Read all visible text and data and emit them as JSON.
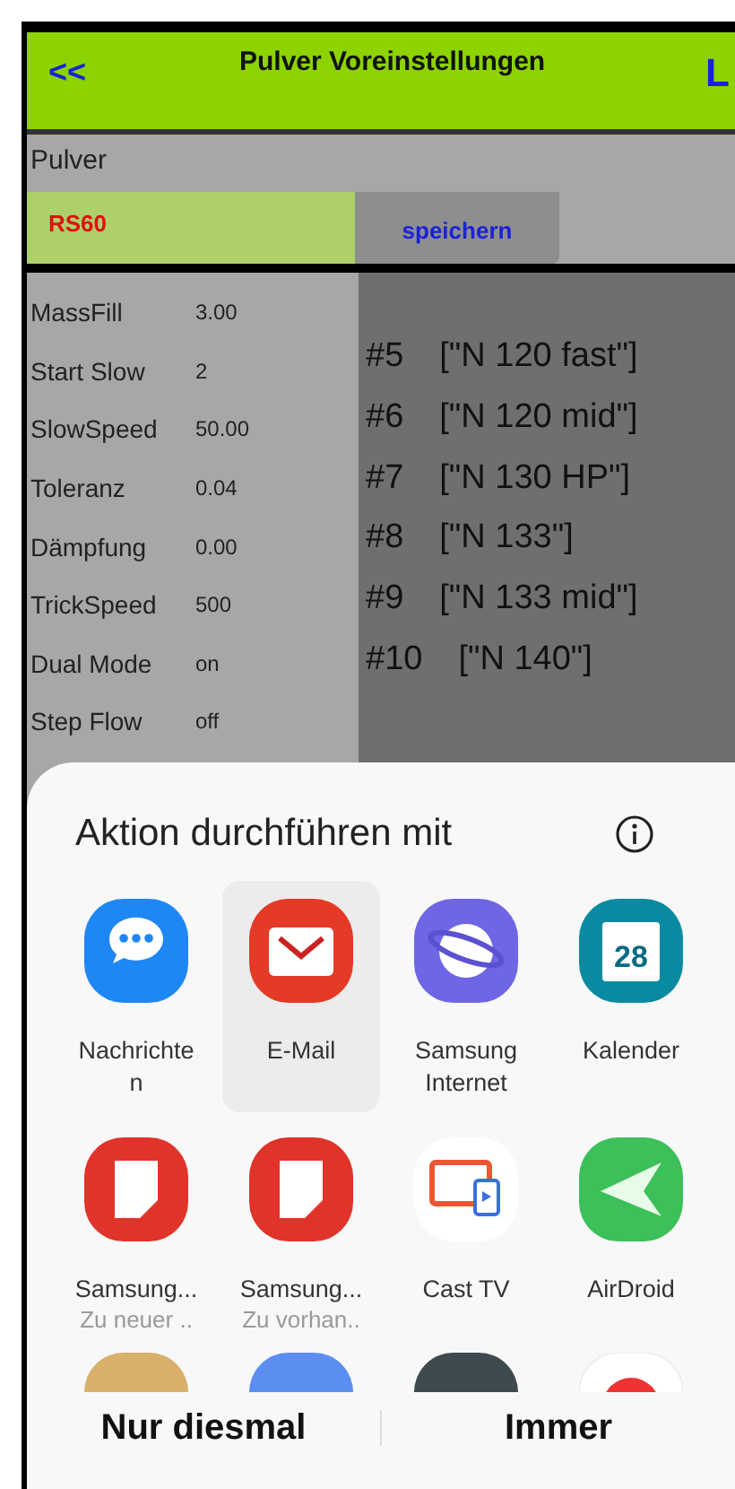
{
  "header": {
    "back": "<<",
    "title": "Pulver Voreinstellungen",
    "right": "L"
  },
  "powder": {
    "label": "Pulver",
    "value": "RS60",
    "save": "speichern"
  },
  "params": [
    {
      "name": "MassFill",
      "value": "3.00"
    },
    {
      "name": "Start Slow",
      "value": "2"
    },
    {
      "name": "SlowSpeed",
      "value": "50.00"
    },
    {
      "name": "Toleranz",
      "value": "0.04"
    },
    {
      "name": "Dämpfung",
      "value": "0.00"
    },
    {
      "name": "TrickSpeed",
      "value": "500"
    },
    {
      "name": "Dual Mode",
      "value": "on"
    },
    {
      "name": "Step Flow",
      "value": "off"
    }
  ],
  "presets": [
    {
      "number": "#5",
      "name": "[\"N 120 fast\"]"
    },
    {
      "number": "#6",
      "name": "[\"N 120 mid\"]"
    },
    {
      "number": "#7",
      "name": "[\"N 130 HP\"]"
    },
    {
      "number": "#8",
      "name": "[\"N 133\"]"
    },
    {
      "number": "#9",
      "name": "[\"N 133 mid\"]"
    },
    {
      "number": "#10",
      "name": "[\"N 140\"]"
    }
  ],
  "sheet": {
    "title": "Aktion durchführen mit",
    "apps": [
      {
        "kind": "messages",
        "name": "Nachrichten",
        "selected": false
      },
      {
        "kind": "mail",
        "name": "E-Mail",
        "selected": true
      },
      {
        "kind": "browser",
        "name": "Samsung Internet",
        "selected": false
      },
      {
        "kind": "calendar",
        "name": "Kalender",
        "badge": "28",
        "selected": false
      },
      {
        "kind": "notes",
        "name": "Samsung...",
        "subtitle": "Zu neuer ..",
        "selected": false
      },
      {
        "kind": "notes",
        "name": "Samsung...",
        "subtitle": "Zu vorhan..",
        "selected": false
      },
      {
        "kind": "cast",
        "name": "Cast TV",
        "selected": false
      },
      {
        "kind": "airdroid",
        "name": "AirDroid",
        "selected": false
      }
    ],
    "buttons": [
      "Nur diesmal",
      "Immer"
    ]
  }
}
